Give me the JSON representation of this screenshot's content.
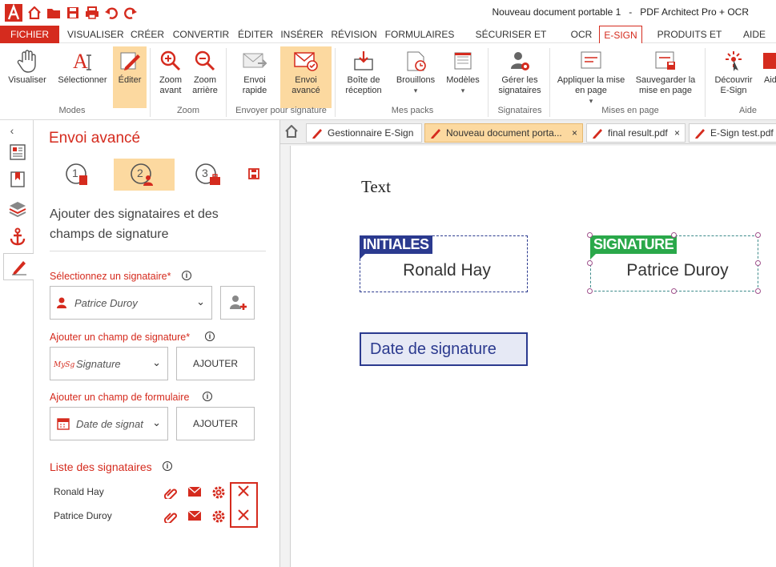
{
  "titlebar": {
    "title": "Nouveau document portable 1   -   PDF Architect Pro + OCR",
    "icons": [
      "app-logo",
      "home-icon",
      "open-folder-icon",
      "save-icon",
      "print-icon",
      "undo-icon",
      "redo-icon"
    ]
  },
  "menu": {
    "tabs": [
      "FICHIER",
      "VISUALISER",
      "CRÉER",
      "CONVERTIR",
      "ÉDITER",
      "INSÉRER",
      "RÉVISION",
      "FORMULAIRES",
      "SÉCURISER ET SIGNER",
      "OCR",
      "E-SIGN",
      "PRODUITS ET PRIX",
      "AIDE"
    ],
    "active": "E-SIGN"
  },
  "ribbon": {
    "buttons": {
      "visualiser": "Visualiser",
      "selectionner": "Sélectionner",
      "editer": "Éditer",
      "zoom_avant": "Zoom avant",
      "zoom_arriere": "Zoom arrière",
      "envoi_rapide": "Envoi rapide",
      "envoi_avance": "Envoi avancé",
      "boite_reception": "Boîte de réception",
      "brouillons": "Brouillons",
      "modeles": "Modèles",
      "gerer_signataires": "Gérer les signataires",
      "appliquer_mise": "Appliquer la mise en page",
      "sauvegarder_mise": "Sauvegarder la mise en page",
      "decouvrir": "Découvrir E-Sign",
      "aide": "Aid"
    },
    "groups": {
      "modes": "Modes",
      "zoom": "Zoom",
      "envoyer": "Envoyer pour signature",
      "packs": "Mes packs",
      "signataires": "Signataires",
      "mise": "Mises en page",
      "aide": "Aide"
    }
  },
  "panel": {
    "title": "Envoi avancé",
    "steps": [
      "1",
      "2",
      "3"
    ],
    "subtitle": "Ajouter des signataires et des champs de signature",
    "select_signer_label": "Sélectionnez un signataire",
    "selected_signer": "Patrice Duroy",
    "add_sig_field_label": "Ajouter un champ de signature",
    "sig_field_value": "Signature",
    "add_button": "AJOUTER",
    "add_form_field_label": "Ajouter un champ de formulaire",
    "form_field_value": "Date de signat",
    "add_button2": "AJOUTER",
    "signer_list_label": "Liste des signataires",
    "signers": [
      {
        "name": "Ronald Hay"
      },
      {
        "name": "Patrice Duroy"
      }
    ],
    "required_mark": "*"
  },
  "doc_tabs": [
    {
      "label": "Gestionnaire E-Sign"
    },
    {
      "label": "Nouveau document porta...",
      "close": "×"
    },
    {
      "label": "final result.pdf",
      "close": "×"
    },
    {
      "label": "E-Sign test.pdf"
    }
  ],
  "document": {
    "text": "Text",
    "initials_tag": "INITIALES",
    "initials_name": "Ronald Hay",
    "signature_tag": "SIGNATURE",
    "signature_name": "Patrice Duroy",
    "date_field": "Date de signature"
  },
  "colors": {
    "accent": "#d52b1e",
    "highlight": "#fcd9a0",
    "initials_blue": "#2b3a8f",
    "signature_green": "#2aa84a"
  }
}
